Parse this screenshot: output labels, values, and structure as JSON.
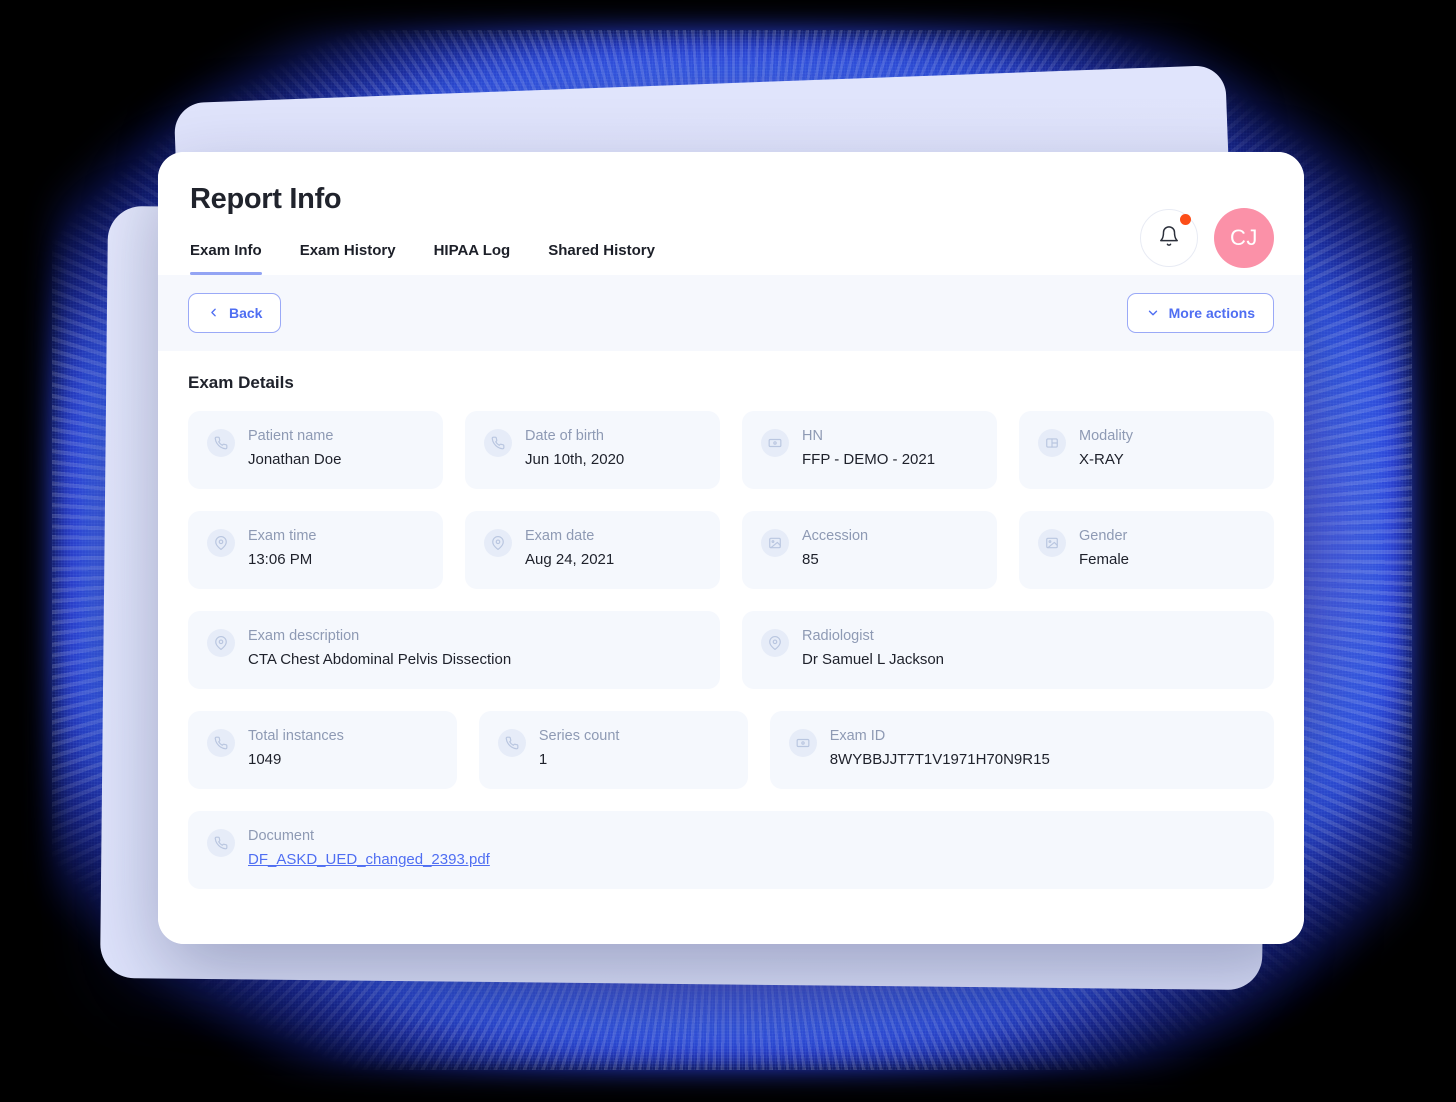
{
  "header": {
    "title": "Report Info",
    "avatar_initials": "CJ",
    "bell_icon": "bell-icon",
    "notification_dot": true,
    "avatar_color": "#fb91a8",
    "dot_color": "#fc4d18"
  },
  "tabs": [
    {
      "label": "Exam Info",
      "active": true
    },
    {
      "label": "Exam History",
      "active": false
    },
    {
      "label": "HIPAA Log",
      "active": false
    },
    {
      "label": "Shared History",
      "active": false
    }
  ],
  "toolbar": {
    "back_label": "Back",
    "back_icon": "chevron-left-icon",
    "more_actions_label": "More actions",
    "more_actions_icon": "chevron-down-icon",
    "accent_color": "#4f6ef2"
  },
  "details": {
    "section_title": "Exam Details",
    "rows": [
      [
        {
          "label": "Patient name",
          "value": "Jonathan Doe",
          "icon": "phone-icon",
          "span": 1
        },
        {
          "label": "Date of birth",
          "value": "Jun 10th, 2020",
          "icon": "phone-icon",
          "span": 1
        },
        {
          "label": "HN",
          "value": "FFP -  DEMO - 2021",
          "icon": "card-icon",
          "span": 1
        },
        {
          "label": "Modality",
          "value": "X-RAY",
          "icon": "layout-icon",
          "span": 1
        }
      ],
      [
        {
          "label": "Exam time",
          "value": "13:06 PM",
          "icon": "map-pin-icon",
          "span": 1
        },
        {
          "label": "Exam date",
          "value": "Aug 24, 2021",
          "icon": "map-pin-icon",
          "span": 1
        },
        {
          "label": "Accession",
          "value": "85",
          "icon": "image-icon",
          "span": 1
        },
        {
          "label": "Gender",
          "value": "Female",
          "icon": "image-icon",
          "span": 1
        }
      ],
      [
        {
          "label": "Exam description",
          "value": "CTA Chest Abdominal Pelvis Dissection",
          "icon": "map-pin-icon",
          "span": 2
        },
        {
          "label": "Radiologist",
          "value": "Dr Samuel L Jackson",
          "icon": "map-pin-icon",
          "span": 2
        }
      ],
      [
        {
          "label": "Total instances",
          "value": "1049",
          "icon": "phone-icon",
          "span": 1
        },
        {
          "label": "Series count",
          "value": "1",
          "icon": "phone-icon",
          "span": 1
        },
        {
          "label": "Exam ID",
          "value": "8WYBBJJT7T1V1971H70N9R15",
          "icon": "card-icon",
          "span": 2
        }
      ],
      [
        {
          "label": "Document",
          "value": "DF_ASKD_UED_changed_2393.pdf",
          "icon": "phone-icon",
          "span": 4,
          "is_link": true
        }
      ]
    ]
  }
}
